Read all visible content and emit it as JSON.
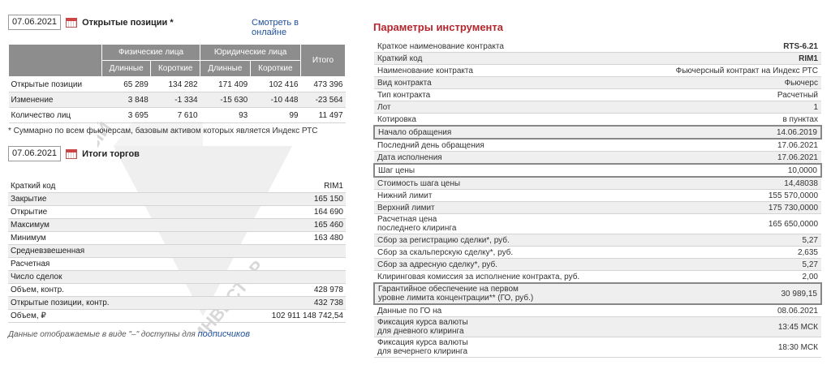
{
  "positions": {
    "date": "07.06.2021",
    "title": "Открытые позиции *",
    "view_link": "Смотреть в онлайне",
    "header": {
      "phys": "Физические лица",
      "legal": "Юридические лица",
      "total": "Итого",
      "long": "Длинные",
      "short": "Короткие"
    },
    "rows": [
      {
        "label": "Открытые позиции",
        "pl": "65 289",
        "ps": "134 282",
        "ll": "171 409",
        "ls": "102 416",
        "t": "473 396"
      },
      {
        "label": "Изменение",
        "pl": "3 848",
        "ps": "-1 334",
        "ll": "-15 630",
        "ls": "-10 448",
        "t": "-23 564"
      },
      {
        "label": "Количество лиц",
        "pl": "3 695",
        "ps": "7 610",
        "ll": "93",
        "ls": "99",
        "t": "11 497"
      }
    ],
    "note": "* Суммарно по всем фьючерсам, базовым активом которых является Индекс РТС"
  },
  "trades": {
    "date": "07.06.2021",
    "title": "Итоги торгов",
    "rows": [
      {
        "label": "Краткий код",
        "value": "RIM1"
      },
      {
        "label": "Закрытие",
        "value": "165 150"
      },
      {
        "label": "Открытие",
        "value": "164 690"
      },
      {
        "label": "Максимум",
        "value": "165 460"
      },
      {
        "label": "Минимум",
        "value": "163 480"
      },
      {
        "label": "Средневзвешенная",
        "value": ""
      },
      {
        "label": "Расчетная",
        "value": ""
      },
      {
        "label": "Число сделок",
        "value": ""
      },
      {
        "label": "Объем, контр.",
        "value": "428 978"
      },
      {
        "label": "Открытые позиции, контр.",
        "value": "432 738"
      },
      {
        "label": "Объем, ₽",
        "value": "102 911 148 742,54"
      }
    ],
    "footer_text": "Данные отображаемые в виде \"–\" доступны для ",
    "footer_link": "подписчиков"
  },
  "params": {
    "title": "Параметры инструмента",
    "rows": [
      {
        "label": "Краткое наименование контракта",
        "value": "RTS-6.21"
      },
      {
        "label": "Краткий код",
        "value": "RIM1"
      },
      {
        "label": "Наименование контракта",
        "value": "Фьючерсный контракт на Индекс РТС"
      },
      {
        "label": "Вид контракта",
        "value": "Фьючерс"
      },
      {
        "label": "Тип контракта",
        "value": "Расчетный"
      },
      {
        "label": "Лот",
        "value": "1"
      },
      {
        "label": "Котировка",
        "value": "в пунктах"
      },
      {
        "label": "Начало обращения",
        "value": "14.06.2019"
      },
      {
        "label": "Последний день обращения",
        "value": "17.06.2021"
      },
      {
        "label": "Дата исполнения",
        "value": "17.06.2021"
      },
      {
        "label": "Шаг цены",
        "value": "10,0000"
      },
      {
        "label": "Стоимость шага цены",
        "value": "14,48038"
      },
      {
        "label": "Нижний лимит",
        "value": "155 570,0000"
      },
      {
        "label": "Верхний лимит",
        "value": "175 730,0000"
      },
      {
        "label": "Расчетная цена",
        "label2": "последнего клиринга",
        "value": "165 650,0000"
      },
      {
        "label": "Сбор за регистрацию сделки*, руб.",
        "value": "5,27"
      },
      {
        "label": "Сбор за скальперскую сделку*, руб.",
        "value": "2,635"
      },
      {
        "label": "Сбор за адресную сделку*, руб.",
        "value": "5,27"
      },
      {
        "label": "Клиринговая комиссия за исполнение контракта, руб.",
        "value": "2,00"
      },
      {
        "label": "Гарантийное обеспечение на первом",
        "label2": "уровне лимита концентрации** (ГО, руб.)",
        "value": "30 989,15"
      },
      {
        "label": "Данные по ГО на",
        "value": "08.06.2021"
      },
      {
        "label": "Фиксация курса валюты",
        "label2": "для дневного клиринга",
        "value": "13:45 МСК"
      },
      {
        "label": "Фиксация курса валюты",
        "label2": "для вечернего клиринга",
        "value": "18:30 МСК"
      }
    ]
  },
  "watermark": {
    "left": "УЧЕНЫЙ",
    "right": "ИНВЕСТОР"
  }
}
